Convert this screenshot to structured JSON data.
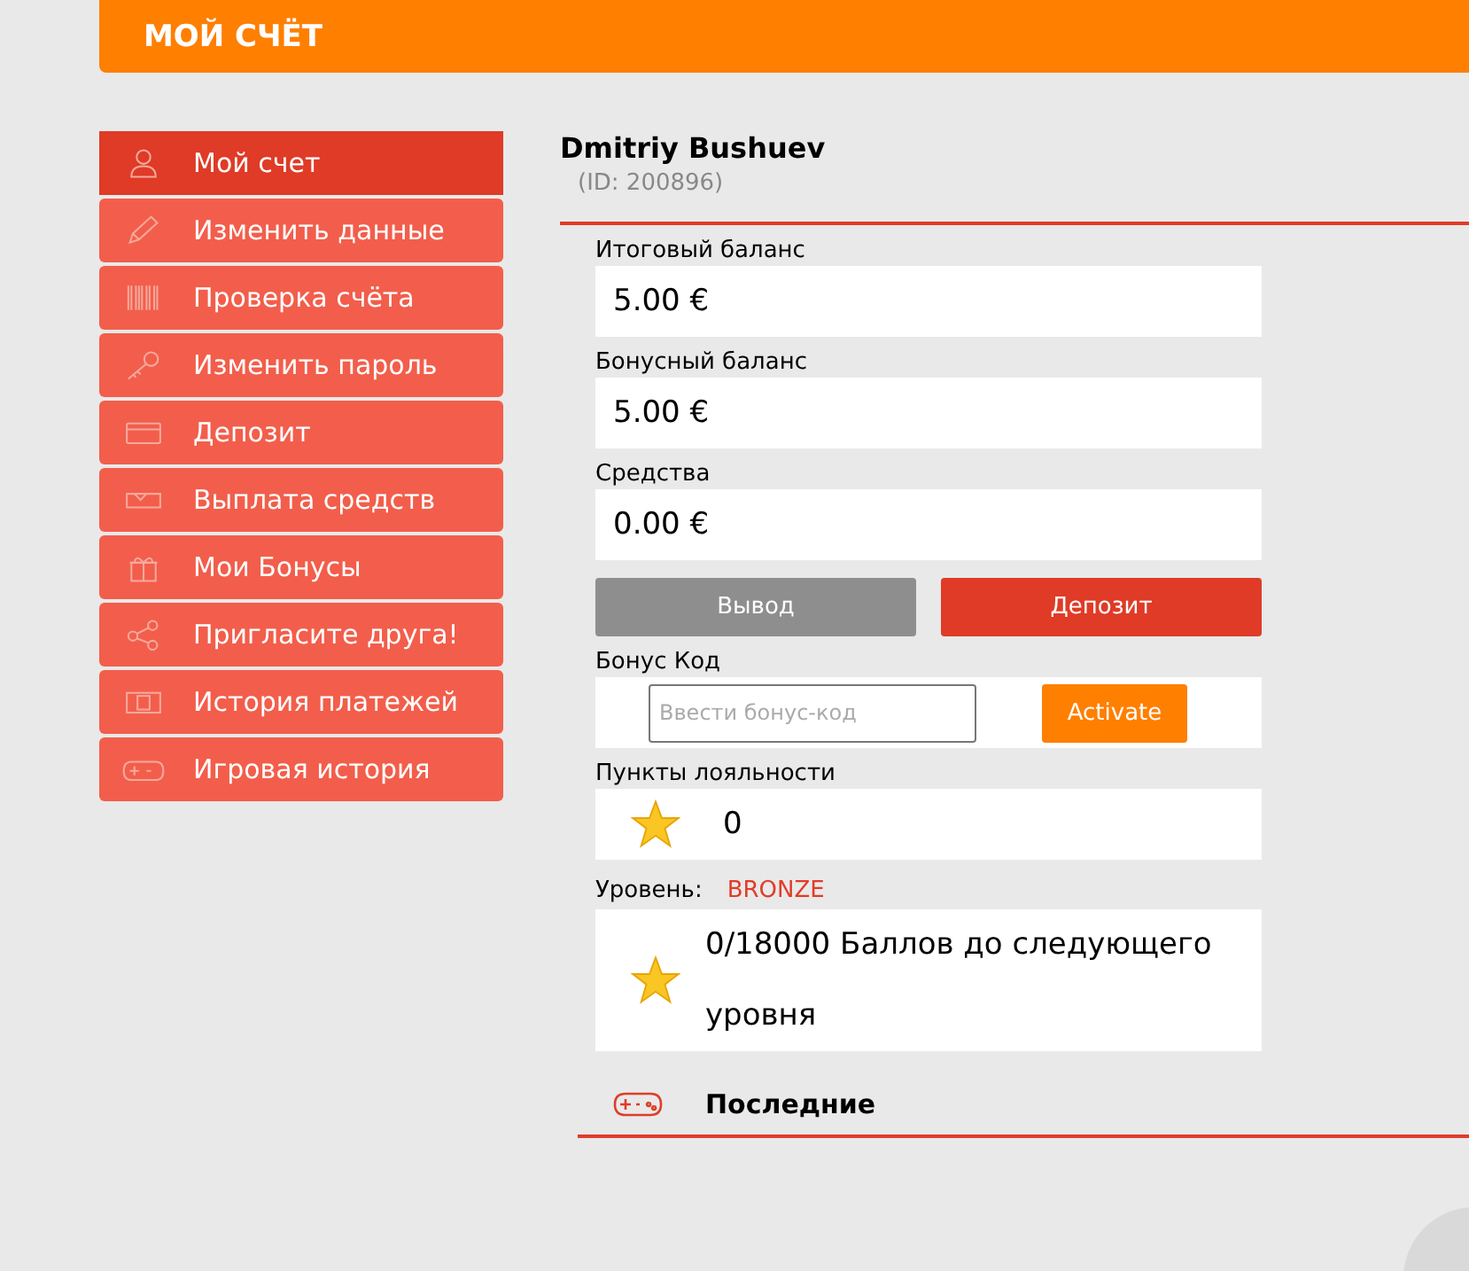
{
  "header": {
    "title": "МОЙ СЧЁТ"
  },
  "sidebar": {
    "items": [
      {
        "label": "Мой счет",
        "selected": true
      },
      {
        "label": "Изменить данные",
        "selected": false
      },
      {
        "label": "Проверка счёта",
        "selected": false
      },
      {
        "label": "Изменить пароль",
        "selected": false
      },
      {
        "label": "Депозит",
        "selected": false
      },
      {
        "label": "Выплата средств",
        "selected": false
      },
      {
        "label": "Мои Бонусы",
        "selected": false
      },
      {
        "label": "Пригласите друга!",
        "selected": false
      },
      {
        "label": "История платежей",
        "selected": false
      },
      {
        "label": "Игровая история",
        "selected": false
      }
    ]
  },
  "profile": {
    "name": "Dmitriy Bushuev",
    "id": "(ID: 200896)"
  },
  "balances": [
    {
      "label": "Итоговый баланс",
      "value": "5.00 €"
    },
    {
      "label": "Бонусный баланс",
      "value": "5.00 €"
    },
    {
      "label": "Средства",
      "value": "0.00 €"
    }
  ],
  "buttons": {
    "withdraw": "Вывод",
    "deposit": "Депозит"
  },
  "bonus_code": {
    "label": "Бонус Код",
    "placeholder": "Ввести бонус-код",
    "button": "Activate"
  },
  "loyalty": {
    "label": "Пункты лояльности",
    "points": "0"
  },
  "level": {
    "label": "Уровень:",
    "value": "BRONZE",
    "progress": "0/18000 Баллов до следующего уровня"
  },
  "recent": {
    "title": "Последние"
  }
}
